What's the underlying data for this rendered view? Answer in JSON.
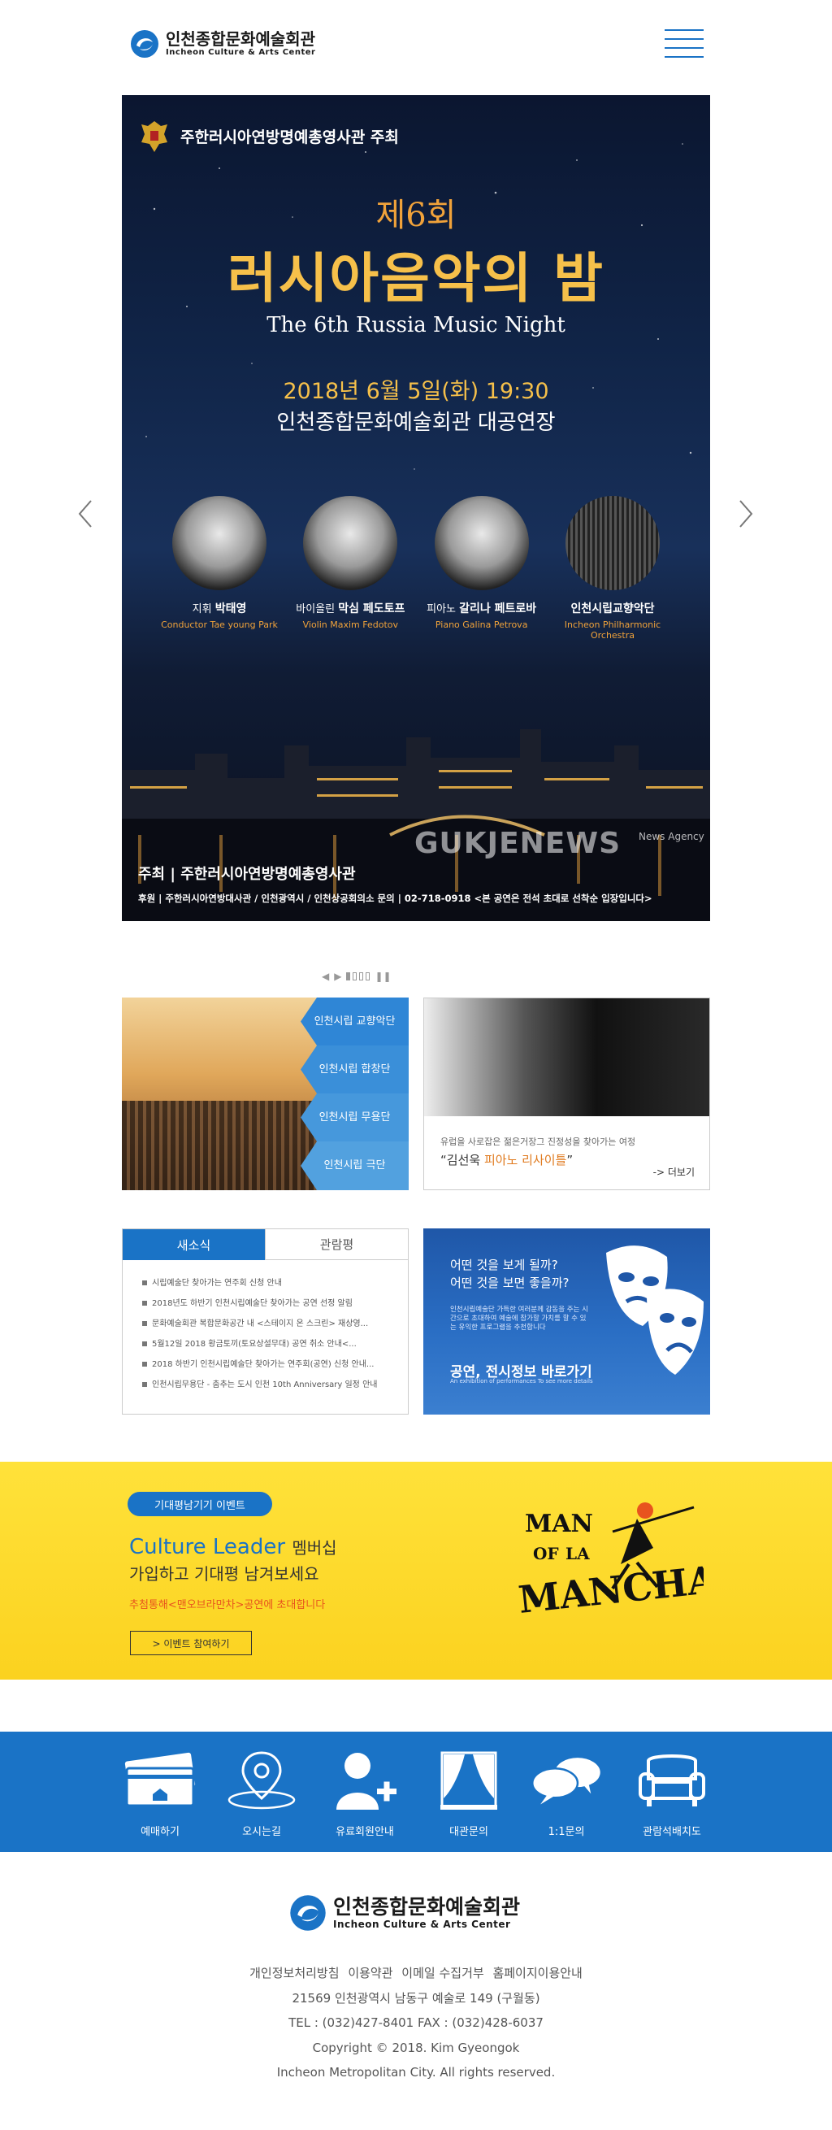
{
  "header": {
    "logo_ko": "인천종합문화예술회관",
    "logo_en": "Incheon Culture & Arts Center",
    "menu_icon": "hamburger-menu-icon"
  },
  "hero": {
    "host": "주한러시아연방명예총영사관 주최",
    "nth": "제6회",
    "title": "러시아음악의 밤",
    "title_en": "The 6th Russia Music Night",
    "date": "2018년 6월 5일(화) 19:30",
    "venue": "인천종합문화예술회관 대공연장",
    "performers": [
      {
        "role": "지휘",
        "name": "박태영",
        "en": "Conductor Tae young Park"
      },
      {
        "role": "바이올린",
        "name": "막심 페도토프",
        "en": "Violin Maxim Fedotov"
      },
      {
        "role": "피아노",
        "name": "갈리나 페트로바",
        "en": "Piano Galina Petrova"
      },
      {
        "role": "",
        "name": "인천시립교향악단",
        "en": "Incheon Philharmonic Orchestra"
      }
    ],
    "organizer": "주최 | 주한러시아연방명예총영사관",
    "sponsors": "후원 | 주한러시아연방대사관 / 인천광역시 / 인천상공회의소    문의 | 02-718-0918    <본 공연은 전석 초대로 선착순 입장입니다>",
    "watermark": "GUKJENEWS",
    "watermark_small": "News Agency",
    "prev_icon": "chevron-left-icon",
    "next_icon": "chevron-right-icon"
  },
  "slider_controls": {
    "prev": "◀",
    "next": "▶",
    "pause": "❚❚"
  },
  "orchestra_tile": {
    "items": [
      "인천시립 교향악단",
      "인천시립 합창단",
      "인천시립 무용단",
      "인천시립 극단"
    ],
    "colors": [
      "#2f86d6",
      "#3a8fd9",
      "#4698dc",
      "#52a1df"
    ]
  },
  "piano_tile": {
    "sub": "유럽을 사로잡은 젊은거장그 진정성을 찾아가는 여정",
    "title_quote_open": "“김선욱 ",
    "title_highlight": "피아노 리사이틀",
    "title_quote_close": "”",
    "more": "-> 더보기"
  },
  "news": {
    "tabs": [
      "새소식",
      "관람평"
    ],
    "items": [
      "시립예술단 찾아가는 연주회 신청 안내",
      "2018년도 하반기 인천시립예술단 찾아가는 공연 선정 알림",
      "문화예술회관 복합문화공간 내 <스테이지 온 스크린> 재상영...",
      "5월12일 2018 황금토끼(토요상설무대) 공연 취소 안내<...",
      "2018 하반기 인천시립예술단 찾아가는 연주회(공연) 신청 안내...",
      "인천시립무용단 - 춤추는 도시 인천 10th Anniversary 일정 안내"
    ]
  },
  "show_tile": {
    "q1": "어떤 것을 보게 될까?",
    "q2": "어떤 것을 보면 좋을까?",
    "desc": "인천시립예술단 가득한 여러분께 감동을 주는 시간으로 초대하여 예술에 참가할 가치를 할 수 있는 유익한 프로그램을 추천합니다",
    "link": "공연, 전시정보 바로가기",
    "link_sub": "An exhibition of performances To see more details"
  },
  "event": {
    "badge": "기대평남기기 이벤트",
    "line1_highlight": "Culture Leader",
    "line1_rest": "멤버십",
    "line2": "가입하고 기대평 남겨보세요",
    "note_pre": "추첨통해<",
    "note_highlight": "맨오브라만차",
    "note_post": ">공연에 초대합니다",
    "button": "> 이벤트 참여하기",
    "poster_text": "MAN OF LA MANCHA"
  },
  "quick_menu": [
    {
      "label": "예매하기",
      "icon": "ticket-icon"
    },
    {
      "label": "오시는길",
      "icon": "location-pin-icon"
    },
    {
      "label": "유료회원안내",
      "icon": "add-user-icon"
    },
    {
      "label": "대관문의",
      "icon": "stage-curtain-icon"
    },
    {
      "label": "1:1문의",
      "icon": "chat-bubbles-icon"
    },
    {
      "label": "관람석배치도",
      "icon": "sofa-icon"
    }
  ],
  "footer": {
    "logo_ko": "인천종합문화예술회관",
    "logo_en": "Incheon Culture & Arts Center",
    "links": [
      "개인정보처리방침",
      "이용약관",
      "이메일 수집거부",
      "홈페이지이용안내"
    ],
    "address": "21569 인천광역시 남동구 예술로 149 (구월동)",
    "tel": "TEL : (032)427-8401 FAX : (032)428-6037",
    "copyright": "Copyright © 2018. Kim Gyeongok",
    "rights": "Incheon Metropolitan City. All rights reserved."
  },
  "colors": {
    "brand_blue": "#1a73c6",
    "gold": "#f6c04a",
    "banner_yellow": "#fbd21f",
    "accent_orange": "#e8531e"
  }
}
